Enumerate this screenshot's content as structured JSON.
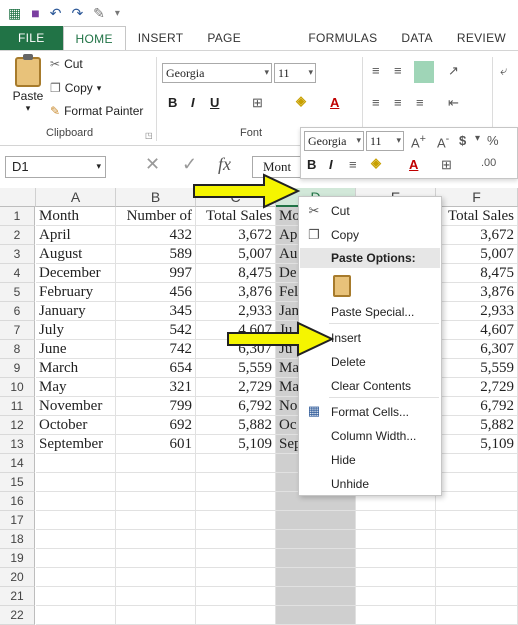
{
  "ribbon_tabs": [
    "FILE",
    "HOME",
    "INSERT",
    "PAGE LAYOUT",
    "FORMULAS",
    "DATA",
    "REVIEW"
  ],
  "clipboard": {
    "paste": "Paste",
    "cut": "Cut",
    "copy": "Copy",
    "format_painter": "Format Painter",
    "group": "Clipboard"
  },
  "font": {
    "name": "Georgia",
    "size": "11",
    "group": "Font"
  },
  "name_box": "D1",
  "formula_value": "Mont",
  "mini_toolbar": {
    "font": "Georgia",
    "size": "11"
  },
  "columns": [
    "A",
    "B",
    "C",
    "D",
    "E",
    "F"
  ],
  "rows": [
    "1",
    "2",
    "3",
    "4",
    "5",
    "6",
    "7",
    "8",
    "9",
    "10",
    "11",
    "12",
    "13",
    "14",
    "15",
    "16",
    "17",
    "18",
    "19",
    "20",
    "21",
    "22"
  ],
  "headers": {
    "a": "Month",
    "b": "Number of",
    "c": "Total Sales",
    "d": "Mo",
    "f": "Total Sales"
  },
  "data": [
    {
      "a": "April",
      "b": "432",
      "c": "3,672",
      "d": "Ap",
      "f": "3,672"
    },
    {
      "a": "August",
      "b": "589",
      "c": "5,007",
      "d": "Au",
      "f": "5,007"
    },
    {
      "a": "December",
      "b": "997",
      "c": "8,475",
      "d": "De",
      "f": "8,475"
    },
    {
      "a": "February",
      "b": "456",
      "c": "3,876",
      "d": "Fel",
      "f": "3,876"
    },
    {
      "a": "January",
      "b": "345",
      "c": "2,933",
      "d": "Jan",
      "f": "2,933"
    },
    {
      "a": "July",
      "b": "542",
      "c": "4,607",
      "d": "Ju",
      "f": "4,607"
    },
    {
      "a": "June",
      "b": "742",
      "c": "6,307",
      "d": "Ju",
      "f": "6,307"
    },
    {
      "a": "March",
      "b": "654",
      "c": "5,559",
      "d": "Ma",
      "f": "5,559"
    },
    {
      "a": "May",
      "b": "321",
      "c": "2,729",
      "d": "Ma",
      "f": "2,729"
    },
    {
      "a": "November",
      "b": "799",
      "c": "6,792",
      "d": "No",
      "f": "6,792"
    },
    {
      "a": "October",
      "b": "692",
      "c": "5,882",
      "d": "Oc",
      "f": "5,882"
    },
    {
      "a": "September",
      "b": "601",
      "c": "5,109",
      "d": "Sep",
      "f": "5,109"
    }
  ],
  "context_menu": {
    "cut": "Cut",
    "copy": "Copy",
    "paste_options": "Paste Options:",
    "paste_special": "Paste Special...",
    "insert": "Insert",
    "delete": "Delete",
    "clear_contents": "Clear Contents",
    "format_cells": "Format Cells...",
    "column_width": "Column Width...",
    "hide": "Hide",
    "unhide": "Unhide"
  },
  "colors": {
    "excel_green": "#217346",
    "arrow_yellow": "#f5f500"
  }
}
